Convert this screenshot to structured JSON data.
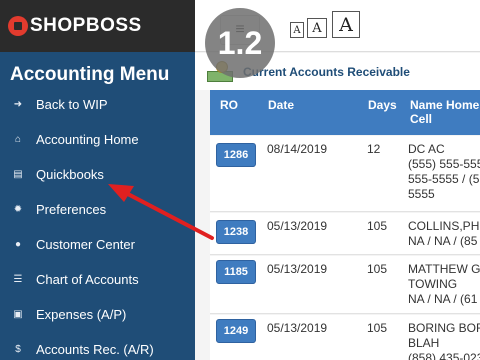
{
  "brand": {
    "name": "SHOPBOSS"
  },
  "version_badge": "1.2",
  "sidebar": {
    "title": "Accounting Menu",
    "items": [
      {
        "label": "Back to WIP",
        "icon": "sign-out-icon"
      },
      {
        "label": "Accounting Home",
        "icon": "home-icon"
      },
      {
        "label": "Quickbooks",
        "icon": "book-icon"
      },
      {
        "label": "Preferences",
        "icon": "gear-icon"
      },
      {
        "label": "Customer Center",
        "icon": "user-icon"
      },
      {
        "label": "Chart of Accounts",
        "icon": "list-icon"
      },
      {
        "label": "Expenses (A/P)",
        "icon": "money-icon"
      },
      {
        "label": "Accounts Rec. (A/R)",
        "icon": "dollar-icon"
      }
    ]
  },
  "toolbar": {
    "menu_glyph": "≡",
    "font_small": "A",
    "font_medium": "A",
    "font_large": "A"
  },
  "panel": {
    "title": "Current Accounts Receivable"
  },
  "table": {
    "headers": {
      "ro": "RO",
      "date": "Date",
      "days": "Days",
      "name_line1": "Name Home",
      "name_line2": "Cell"
    },
    "rows": [
      {
        "ro": "1286",
        "date": "08/14/2019",
        "days": "12",
        "name": [
          "DC AC",
          "(555) 555-555",
          "555-5555 / (5",
          "5555"
        ]
      },
      {
        "ro": "1238",
        "date": "05/13/2019",
        "days": "105",
        "name": [
          "COLLINS,PHI",
          "NA / NA / (85"
        ]
      },
      {
        "ro": "1185",
        "date": "05/13/2019",
        "days": "105",
        "name": [
          "MATTHEW G",
          "TOWING",
          "NA / NA / (61"
        ]
      },
      {
        "ro": "1249",
        "date": "05/13/2019",
        "days": "105",
        "name": [
          "BORING BOR",
          "BLAH",
          "(858) 435-023"
        ]
      }
    ]
  },
  "colors": {
    "sidebar": "#1f4d77",
    "brand_bar": "#2b2b2b",
    "accent": "#3f7cc0",
    "arrow": "#e02020"
  }
}
